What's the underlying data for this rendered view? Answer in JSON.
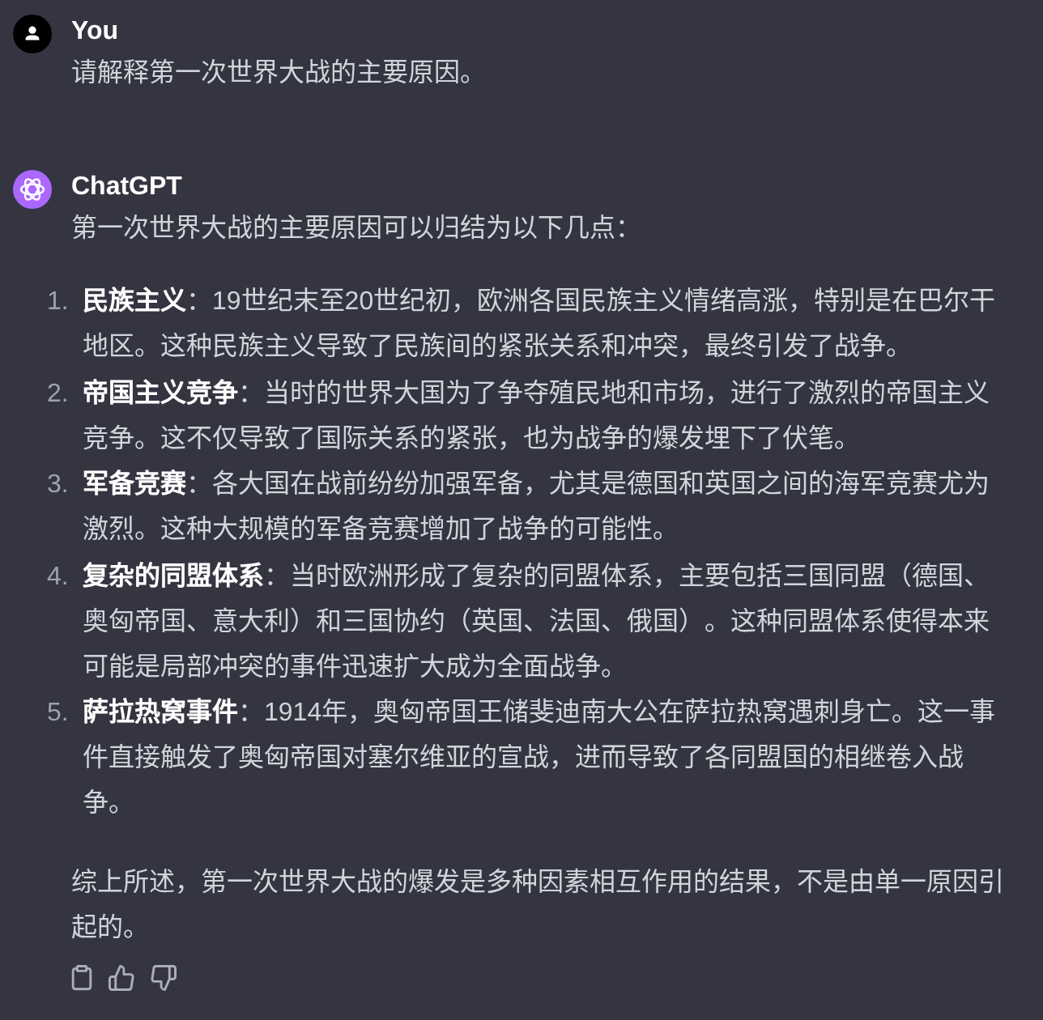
{
  "messages": [
    {
      "kind": "user",
      "author": "You",
      "blocks": [
        {
          "kind": "paragraph",
          "text": "请解释第一次世界大战的主要原因。"
        }
      ]
    },
    {
      "kind": "assistant",
      "author": "ChatGPT",
      "blocks": [
        {
          "kind": "paragraph",
          "text": "第一次世界大战的主要原因可以归结为以下几点："
        },
        {
          "kind": "list",
          "items": [
            {
              "number": "1.",
              "text": "**民族主义**：19世纪末至20世纪初，欧洲各国民族主义情绪高涨，特别是在巴尔干地区。这种民族主义导致了民族间的紧张关系和冲突，最终引发了战争。"
            },
            {
              "number": "2.",
              "text": "**帝国主义竞争**：当时的世界大国为了争夺殖民地和市场，进行了激烈的帝国主义竞争。这不仅导致了国际关系的紧张，也为战争的爆发埋下了伏笔。"
            },
            {
              "number": "3.",
              "text": "**军备竞赛**：各大国在战前纷纷加强军备，尤其是德国和英国之间的海军竞赛尤为激烈。这种大规模的军备竞赛增加了战争的可能性。"
            },
            {
              "number": "4.",
              "text": "**复杂的同盟体系**：当时欧洲形成了复杂的同盟体系，主要包括三国同盟（德国、奥匈帝国、意大利）和三国协约（英国、法国、俄国）。这种同盟体系使得本来可能是局部冲突的事件迅速扩大成为全面战争。"
            },
            {
              "number": "5.",
              "text": "**萨拉热窝事件**：1914年，奥匈帝国王储斐迪南大公在萨拉热窝遇刺身亡。这一事件直接触发了奥匈帝国对塞尔维亚的宣战，进而导致了各同盟国的相继卷入战争。"
            }
          ]
        },
        {
          "kind": "paragraph",
          "text": "综上所述，第一次世界大战的爆发是多种因素相互作用的结果，不是由单一原因引起的。"
        }
      ]
    }
  ]
}
